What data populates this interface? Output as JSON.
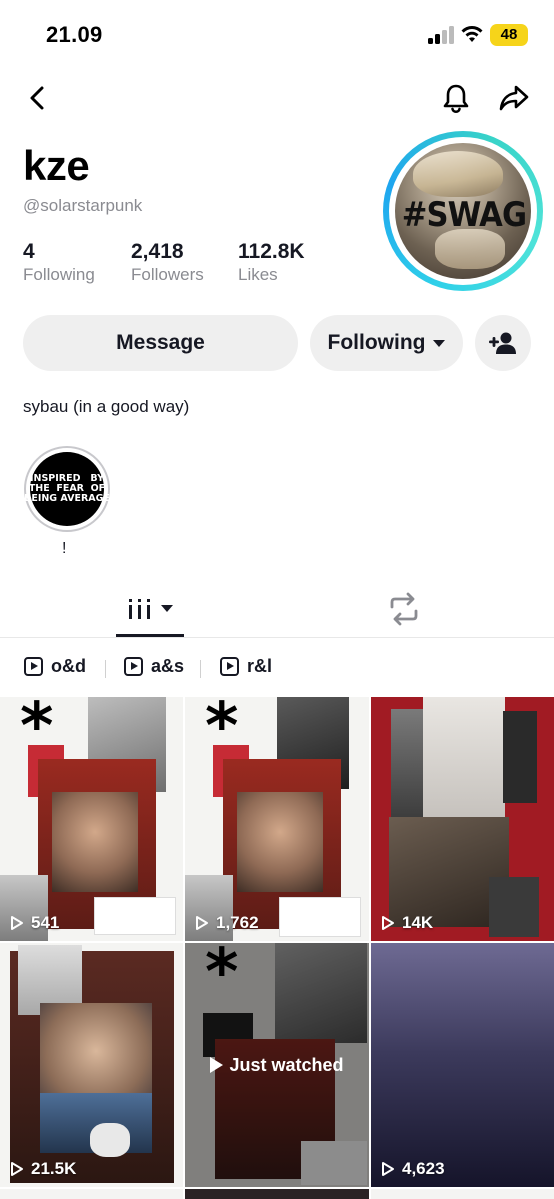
{
  "status_bar": {
    "time": "21.09",
    "battery": "48"
  },
  "profile": {
    "display_name": "kze",
    "handle": "@solarstarpunk",
    "avatar_text": "#SWAG",
    "stats": [
      {
        "value": "4",
        "label": "Following"
      },
      {
        "value": "2,418",
        "label": "Followers"
      },
      {
        "value": "112.8K",
        "label": "Likes"
      }
    ],
    "bio": "sybau (in a good way)"
  },
  "actions": {
    "message_label": "Message",
    "following_label": "Following"
  },
  "highlight": {
    "text": "INSPIRED   BY\nTHE  FEAR  OF\nBEING AVERAGE",
    "label": "!"
  },
  "playlists": [
    "o&d",
    "a&s",
    "r&l"
  ],
  "videos": [
    {
      "views": "541"
    },
    {
      "views": "1,762"
    },
    {
      "views": "14K"
    },
    {
      "views": "21.5K"
    },
    {
      "views": "",
      "overlay": "Just watched"
    },
    {
      "views": "4,623"
    }
  ],
  "colors": {
    "avatar_ring": "#2fd0e9",
    "battery": "#f6d41a",
    "button_bg": "#efefef"
  },
  "icons": [
    "back-icon",
    "bell-icon",
    "share-icon",
    "add-friend-icon",
    "grid-icon",
    "repost-icon",
    "play-icon"
  ]
}
